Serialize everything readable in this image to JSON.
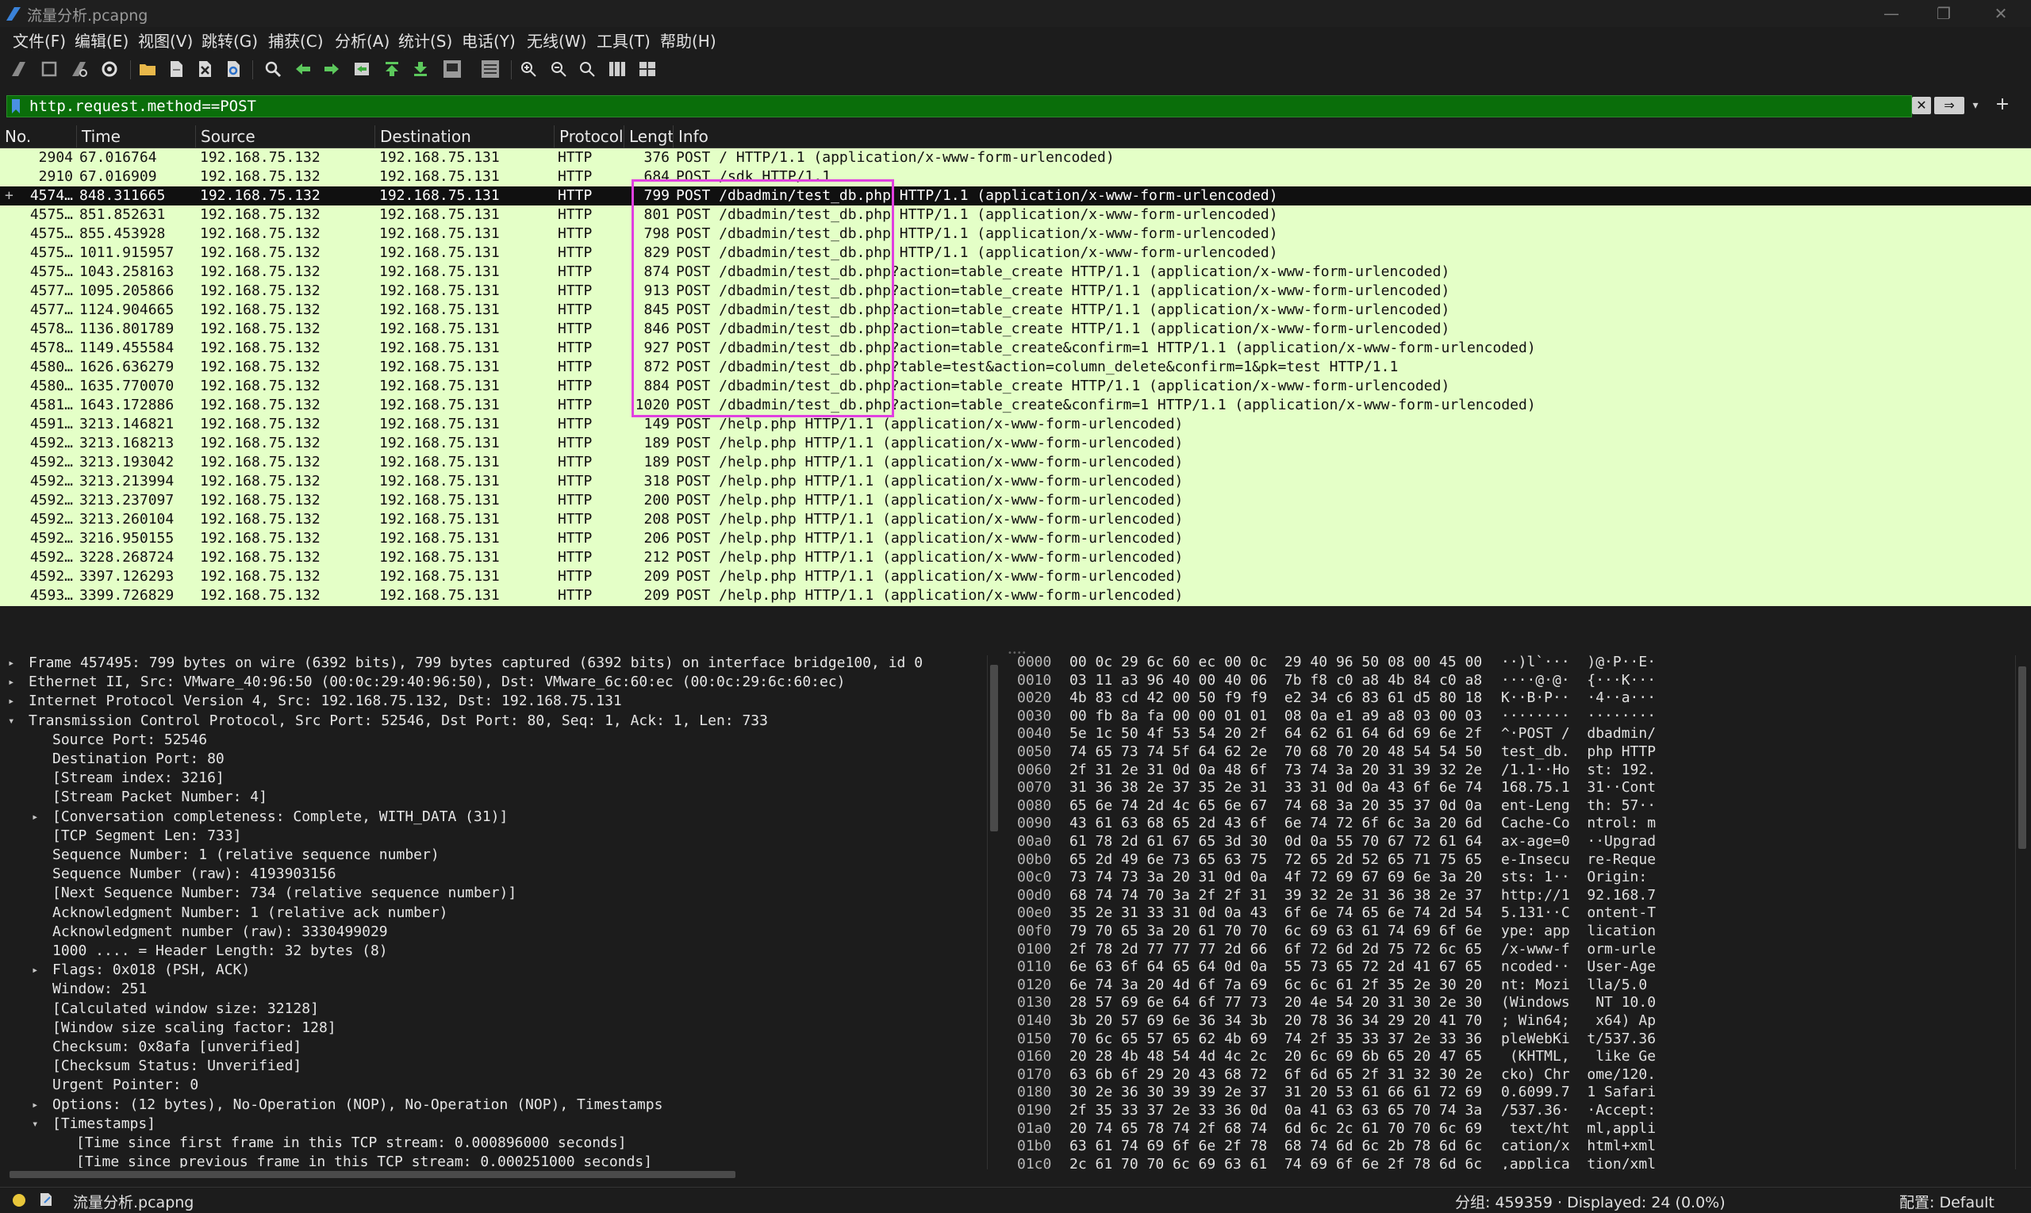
{
  "window": {
    "title": "流量分析.pcapng",
    "minimize": "—",
    "maximize": "❐",
    "close": "✕"
  },
  "menu": [
    "文件(F)",
    "编辑(E)",
    "视图(V)",
    "跳转(G)",
    "捕获(C)",
    "分析(A)",
    "统计(S)",
    "电话(Y)",
    "无线(W)",
    "工具(T)",
    "帮助(H)"
  ],
  "toolbar_icons": [
    "shark-fin-start-icon",
    "stop-square-icon",
    "restart-fin-icon",
    "capture-options-gear-icon",
    "open-folder-icon",
    "save-file-icon",
    "close-file-icon",
    "reload-file-icon",
    "find-packet-magnifier-icon",
    "go-back-arrow-icon",
    "go-forward-arrow-icon",
    "go-to-packet-icon",
    "go-first-packet-icon",
    "go-last-packet-icon",
    "auto-scroll-icon",
    "colorize-lines-icon",
    "zoom-in-icon",
    "zoom-out-icon",
    "normal-size-icon",
    "resize-columns-icon",
    "layout-columns-icon"
  ],
  "filter": {
    "value": "http.request.method==POST",
    "clear_label": "✕",
    "apply_label": "⇒",
    "dropdown_label": "▾",
    "add_label": "+"
  },
  "columns": {
    "no": "No.",
    "time": "Time",
    "source": "Source",
    "destination": "Destination",
    "protocol": "Protocol",
    "length": "Lengtl",
    "info": "Info"
  },
  "packets": [
    {
      "no": "2904",
      "time": "67.016764",
      "src": "192.168.75.132",
      "dst": "192.168.75.131",
      "proto": "HTTP",
      "len": "376",
      "info": "POST / HTTP/1.1  (application/x-www-form-urlencoded)"
    },
    {
      "no": "2910",
      "time": "67.016909",
      "src": "192.168.75.132",
      "dst": "192.168.75.131",
      "proto": "HTTP",
      "len": "684",
      "info": "POST /sdk HTTP/1.1"
    },
    {
      "no": "4574…",
      "time": "848.311665",
      "src": "192.168.75.132",
      "dst": "192.168.75.131",
      "proto": "HTTP",
      "len": "799",
      "info": "POST /dbadmin/test_db.php HTTP/1.1  (application/x-www-form-urlencoded)",
      "selected": true
    },
    {
      "no": "4575…",
      "time": "851.852631",
      "src": "192.168.75.132",
      "dst": "192.168.75.131",
      "proto": "HTTP",
      "len": "801",
      "info": "POST /dbadmin/test_db.php HTTP/1.1  (application/x-www-form-urlencoded)"
    },
    {
      "no": "4575…",
      "time": "855.453928",
      "src": "192.168.75.132",
      "dst": "192.168.75.131",
      "proto": "HTTP",
      "len": "798",
      "info": "POST /dbadmin/test_db.php HTTP/1.1  (application/x-www-form-urlencoded)"
    },
    {
      "no": "4575…",
      "time": "1011.915957",
      "src": "192.168.75.132",
      "dst": "192.168.75.131",
      "proto": "HTTP",
      "len": "829",
      "info": "POST /dbadmin/test_db.php HTTP/1.1  (application/x-www-form-urlencoded)"
    },
    {
      "no": "4575…",
      "time": "1043.258163",
      "src": "192.168.75.132",
      "dst": "192.168.75.131",
      "proto": "HTTP",
      "len": "874",
      "info": "POST /dbadmin/test_db.php?action=table_create HTTP/1.1  (application/x-www-form-urlencoded)"
    },
    {
      "no": "4577…",
      "time": "1095.205866",
      "src": "192.168.75.132",
      "dst": "192.168.75.131",
      "proto": "HTTP",
      "len": "913",
      "info": "POST /dbadmin/test_db.php?action=table_create HTTP/1.1  (application/x-www-form-urlencoded)"
    },
    {
      "no": "4577…",
      "time": "1124.904665",
      "src": "192.168.75.132",
      "dst": "192.168.75.131",
      "proto": "HTTP",
      "len": "845",
      "info": "POST /dbadmin/test_db.php?action=table_create HTTP/1.1  (application/x-www-form-urlencoded)"
    },
    {
      "no": "4578…",
      "time": "1136.801789",
      "src": "192.168.75.132",
      "dst": "192.168.75.131",
      "proto": "HTTP",
      "len": "846",
      "info": "POST /dbadmin/test_db.php?action=table_create HTTP/1.1  (application/x-www-form-urlencoded)"
    },
    {
      "no": "4578…",
      "time": "1149.455584",
      "src": "192.168.75.132",
      "dst": "192.168.75.131",
      "proto": "HTTP",
      "len": "927",
      "info": "POST /dbadmin/test_db.php?action=table_create&confirm=1 HTTP/1.1  (application/x-www-form-urlencoded)"
    },
    {
      "no": "4580…",
      "time": "1626.636279",
      "src": "192.168.75.132",
      "dst": "192.168.75.131",
      "proto": "HTTP",
      "len": "872",
      "info": "POST /dbadmin/test_db.php?table=test&action=column_delete&confirm=1&pk=test HTTP/1.1"
    },
    {
      "no": "4580…",
      "time": "1635.770070",
      "src": "192.168.75.132",
      "dst": "192.168.75.131",
      "proto": "HTTP",
      "len": "884",
      "info": "POST /dbadmin/test_db.php?action=table_create HTTP/1.1  (application/x-www-form-urlencoded)"
    },
    {
      "no": "4581…",
      "time": "1643.172886",
      "src": "192.168.75.132",
      "dst": "192.168.75.131",
      "proto": "HTTP",
      "len": "1020",
      "info": "POST /dbadmin/test_db.php?action=table_create&confirm=1 HTTP/1.1  (application/x-www-form-urlencoded)"
    },
    {
      "no": "4591…",
      "time": "3213.146821",
      "src": "192.168.75.132",
      "dst": "192.168.75.131",
      "proto": "HTTP",
      "len": "149",
      "info": "POST /help.php HTTP/1.1  (application/x-www-form-urlencoded)"
    },
    {
      "no": "4592…",
      "time": "3213.168213",
      "src": "192.168.75.132",
      "dst": "192.168.75.131",
      "proto": "HTTP",
      "len": "189",
      "info": "POST /help.php HTTP/1.1  (application/x-www-form-urlencoded)"
    },
    {
      "no": "4592…",
      "time": "3213.193042",
      "src": "192.168.75.132",
      "dst": "192.168.75.131",
      "proto": "HTTP",
      "len": "189",
      "info": "POST /help.php HTTP/1.1  (application/x-www-form-urlencoded)"
    },
    {
      "no": "4592…",
      "time": "3213.213994",
      "src": "192.168.75.132",
      "dst": "192.168.75.131",
      "proto": "HTTP",
      "len": "318",
      "info": "POST /help.php HTTP/1.1  (application/x-www-form-urlencoded)"
    },
    {
      "no": "4592…",
      "time": "3213.237097",
      "src": "192.168.75.132",
      "dst": "192.168.75.131",
      "proto": "HTTP",
      "len": "200",
      "info": "POST /help.php HTTP/1.1  (application/x-www-form-urlencoded)"
    },
    {
      "no": "4592…",
      "time": "3213.260104",
      "src": "192.168.75.132",
      "dst": "192.168.75.131",
      "proto": "HTTP",
      "len": "208",
      "info": "POST /help.php HTTP/1.1  (application/x-www-form-urlencoded)"
    },
    {
      "no": "4592…",
      "time": "3216.950155",
      "src": "192.168.75.132",
      "dst": "192.168.75.131",
      "proto": "HTTP",
      "len": "206",
      "info": "POST /help.php HTTP/1.1  (application/x-www-form-urlencoded)"
    },
    {
      "no": "4592…",
      "time": "3228.268724",
      "src": "192.168.75.132",
      "dst": "192.168.75.131",
      "proto": "HTTP",
      "len": "212",
      "info": "POST /help.php HTTP/1.1  (application/x-www-form-urlencoded)"
    },
    {
      "no": "4592…",
      "time": "3397.126293",
      "src": "192.168.75.132",
      "dst": "192.168.75.131",
      "proto": "HTTP",
      "len": "209",
      "info": "POST /help.php HTTP/1.1  (application/x-www-form-urlencoded)"
    },
    {
      "no": "4593…",
      "time": "3399.726829",
      "src": "192.168.75.132",
      "dst": "192.168.75.131",
      "proto": "HTTP",
      "len": "209",
      "info": "POST /help.php HTTP/1.1  (application/x-www-form-urlencoded)"
    }
  ],
  "details": [
    {
      "indent": 0,
      "arrow": "closed",
      "text": "Frame 457495: 799 bytes on wire (6392 bits), 799 bytes captured (6392 bits) on interface bridge100, id 0"
    },
    {
      "indent": 0,
      "arrow": "closed",
      "text": "Ethernet II, Src: VMware_40:96:50 (00:0c:29:40:96:50), Dst: VMware_6c:60:ec (00:0c:29:6c:60:ec)"
    },
    {
      "indent": 0,
      "arrow": "closed",
      "text": "Internet Protocol Version 4, Src: 192.168.75.132, Dst: 192.168.75.131"
    },
    {
      "indent": 0,
      "arrow": "open",
      "text": "Transmission Control Protocol, Src Port: 52546, Dst Port: 80, Seq: 1, Ack: 1, Len: 733"
    },
    {
      "indent": 1,
      "arrow": "",
      "text": "Source Port: 52546"
    },
    {
      "indent": 1,
      "arrow": "",
      "text": "Destination Port: 80"
    },
    {
      "indent": 1,
      "arrow": "",
      "text": "[Stream index: 3216]"
    },
    {
      "indent": 1,
      "arrow": "",
      "text": "[Stream Packet Number: 4]"
    },
    {
      "indent": 1,
      "arrow": "closed",
      "text": "[Conversation completeness: Complete, WITH_DATA (31)]"
    },
    {
      "indent": 1,
      "arrow": "",
      "text": "[TCP Segment Len: 733]"
    },
    {
      "indent": 1,
      "arrow": "",
      "text": "Sequence Number: 1    (relative sequence number)"
    },
    {
      "indent": 1,
      "arrow": "",
      "text": "Sequence Number (raw): 4193903156"
    },
    {
      "indent": 1,
      "arrow": "",
      "text": "[Next Sequence Number: 734    (relative sequence number)]"
    },
    {
      "indent": 1,
      "arrow": "",
      "text": "Acknowledgment Number: 1    (relative ack number)"
    },
    {
      "indent": 1,
      "arrow": "",
      "text": "Acknowledgment number (raw): 3330499029"
    },
    {
      "indent": 1,
      "arrow": "",
      "text": "1000 .... = Header Length: 32 bytes (8)"
    },
    {
      "indent": 1,
      "arrow": "closed",
      "text": "Flags: 0x018 (PSH, ACK)"
    },
    {
      "indent": 1,
      "arrow": "",
      "text": "Window: 251"
    },
    {
      "indent": 1,
      "arrow": "",
      "text": "[Calculated window size: 32128]"
    },
    {
      "indent": 1,
      "arrow": "",
      "text": "[Window size scaling factor: 128]"
    },
    {
      "indent": 1,
      "arrow": "",
      "text": "Checksum: 0x8afa [unverified]"
    },
    {
      "indent": 1,
      "arrow": "",
      "text": "[Checksum Status: Unverified]"
    },
    {
      "indent": 1,
      "arrow": "",
      "text": "Urgent Pointer: 0"
    },
    {
      "indent": 1,
      "arrow": "closed",
      "text": "Options: (12 bytes), No-Operation (NOP), No-Operation (NOP), Timestamps"
    },
    {
      "indent": 1,
      "arrow": "open",
      "text": "[Timestamps]"
    },
    {
      "indent": 2,
      "arrow": "",
      "text": "[Time since first frame in this TCP stream: 0.000896000 seconds]"
    },
    {
      "indent": 2,
      "arrow": "",
      "text": "[Time since previous frame in this TCP stream: 0.000251000 seconds]"
    }
  ],
  "bytes": [
    {
      "off": "0000",
      "hex": "00 0c 29 6c 60 ec 00 0c  29 40 96 50 08 00 45 00",
      "asc": "··)l`···  )@·P··E·"
    },
    {
      "off": "0010",
      "hex": "03 11 a3 96 40 00 40 06  7b f8 c0 a8 4b 84 c0 a8",
      "asc": "····@·@·  {···K···"
    },
    {
      "off": "0020",
      "hex": "4b 83 cd 42 00 50 f9 f9  e2 34 c6 83 61 d5 80 18",
      "asc": "K··B·P··  ·4··a···"
    },
    {
      "off": "0030",
      "hex": "00 fb 8a fa 00 00 01 01  08 0a e1 a9 a8 03 00 03",
      "asc": "········  ········"
    },
    {
      "off": "0040",
      "hex": "5e 1c 50 4f 53 54 20 2f  64 62 61 64 6d 69 6e 2f",
      "asc": "^·POST /  dbadmin/"
    },
    {
      "off": "0050",
      "hex": "74 65 73 74 5f 64 62 2e  70 68 70 20 48 54 54 50",
      "asc": "test_db.  php HTTP"
    },
    {
      "off": "0060",
      "hex": "2f 31 2e 31 0d 0a 48 6f  73 74 3a 20 31 39 32 2e",
      "asc": "/1.1··Ho  st: 192."
    },
    {
      "off": "0070",
      "hex": "31 36 38 2e 37 35 2e 31  33 31 0d 0a 43 6f 6e 74",
      "asc": "168.75.1  31··Cont"
    },
    {
      "off": "0080",
      "hex": "65 6e 74 2d 4c 65 6e 67  74 68 3a 20 35 37 0d 0a",
      "asc": "ent-Leng  th: 57··"
    },
    {
      "off": "0090",
      "hex": "43 61 63 68 65 2d 43 6f  6e 74 72 6f 6c 3a 20 6d",
      "asc": "Cache-Co  ntrol: m"
    },
    {
      "off": "00a0",
      "hex": "61 78 2d 61 67 65 3d 30  0d 0a 55 70 67 72 61 64",
      "asc": "ax-age=0  ··Upgrad"
    },
    {
      "off": "00b0",
      "hex": "65 2d 49 6e 73 65 63 75  72 65 2d 52 65 71 75 65",
      "asc": "e-Insecu  re-Reque"
    },
    {
      "off": "00c0",
      "hex": "73 74 73 3a 20 31 0d 0a  4f 72 69 67 69 6e 3a 20",
      "asc": "sts: 1··  Origin: "
    },
    {
      "off": "00d0",
      "hex": "68 74 74 70 3a 2f 2f 31  39 32 2e 31 36 38 2e 37",
      "asc": "http://1  92.168.7"
    },
    {
      "off": "00e0",
      "hex": "35 2e 31 33 31 0d 0a 43  6f 6e 74 65 6e 74 2d 54",
      "asc": "5.131··C  ontent-T"
    },
    {
      "off": "00f0",
      "hex": "79 70 65 3a 20 61 70 70  6c 69 63 61 74 69 6f 6e",
      "asc": "ype: app  lication"
    },
    {
      "off": "0100",
      "hex": "2f 78 2d 77 77 77 2d 66  6f 72 6d 2d 75 72 6c 65",
      "asc": "/x-www-f  orm-urle"
    },
    {
      "off": "0110",
      "hex": "6e 63 6f 64 65 64 0d 0a  55 73 65 72 2d 41 67 65",
      "asc": "ncoded··  User-Age"
    },
    {
      "off": "0120",
      "hex": "6e 74 3a 20 4d 6f 7a 69  6c 6c 61 2f 35 2e 30 20",
      "asc": "nt: Mozi  lla/5.0 "
    },
    {
      "off": "0130",
      "hex": "28 57 69 6e 64 6f 77 73  20 4e 54 20 31 30 2e 30",
      "asc": "(Windows   NT 10.0"
    },
    {
      "off": "0140",
      "hex": "3b 20 57 69 6e 36 34 3b  20 78 36 34 29 20 41 70",
      "asc": "; Win64;   x64) Ap"
    },
    {
      "off": "0150",
      "hex": "70 6c 65 57 65 62 4b 69  74 2f 35 33 37 2e 33 36",
      "asc": "pleWebKi  t/537.36"
    },
    {
      "off": "0160",
      "hex": "20 28 4b 48 54 4d 4c 2c  20 6c 69 6b 65 20 47 65",
      "asc": " (KHTML,   like Ge"
    },
    {
      "off": "0170",
      "hex": "63 6b 6f 29 20 43 68 72  6f 6d 65 2f 31 32 30 2e",
      "asc": "cko) Chr  ome/120."
    },
    {
      "off": "0180",
      "hex": "30 2e 36 30 39 39 2e 37  31 20 53 61 66 61 72 69",
      "asc": "0.6099.7  1 Safari"
    },
    {
      "off": "0190",
      "hex": "2f 35 33 37 2e 33 36 0d  0a 41 63 63 65 70 74 3a",
      "asc": "/537.36·  ·Accept:"
    },
    {
      "off": "01a0",
      "hex": "20 74 65 78 74 2f 68 74  6d 6c 2c 61 70 70 6c 69",
      "asc": " text/ht  ml,appli"
    },
    {
      "off": "01b0",
      "hex": "63 61 74 69 6f 6e 2f 78  68 74 6d 6c 2b 78 6d 6c",
      "asc": "cation/x  html+xml"
    },
    {
      "off": "01c0",
      "hex": "2c 61 70 70 6c 69 63 61  74 69 6f 6e 2f 78 6d 6c",
      "asc": ",applica  tion/xml"
    }
  ],
  "status": {
    "file": "流量分析.pcapng",
    "packets": "分组: 459359 · Displayed: 24 (0.0%)",
    "profile": "配置: Default"
  },
  "colors": {
    "row_bg": "#e4ffc7",
    "selected_row_bg": "#101010",
    "filter_bg": "#0a6e0a",
    "highlight": "#e040e0"
  }
}
